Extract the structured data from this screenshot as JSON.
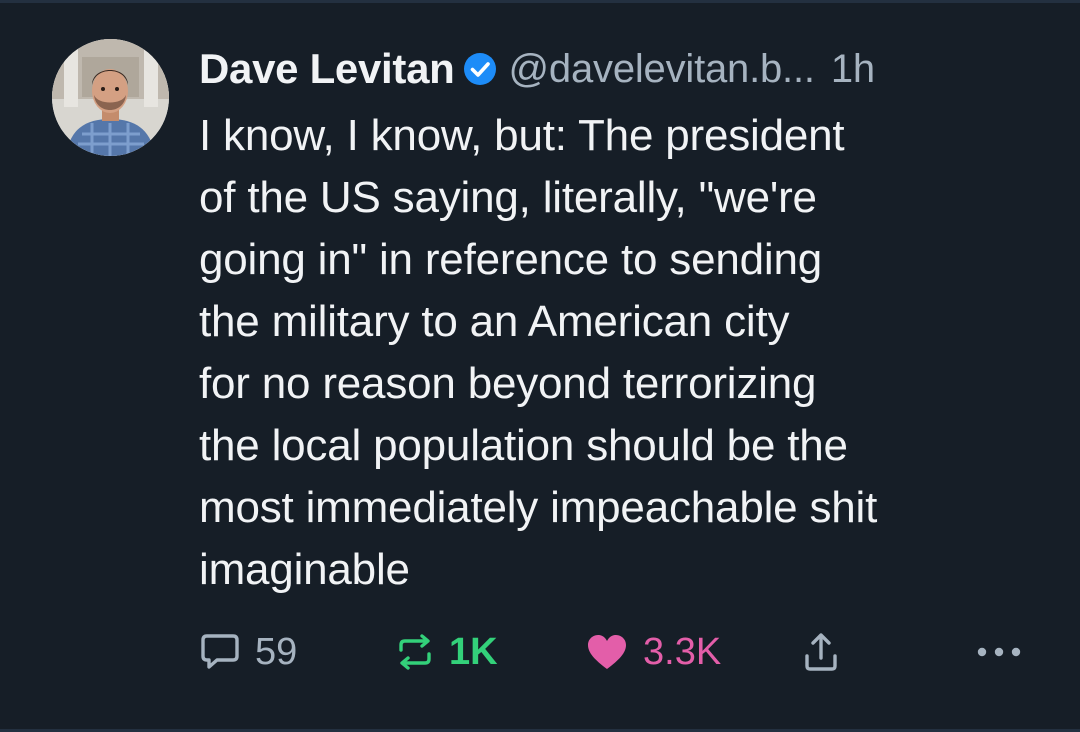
{
  "post": {
    "author": {
      "display_name": "Dave Levitan",
      "handle": "@davelevitan.b...",
      "verified": true
    },
    "timestamp": "1h",
    "text": "I know, I know, but: The president\nof the US saying, literally, \"we're\ngoing in\" in reference to sending\nthe military to an American city\nfor no reason beyond terrorizing\nthe local population should be the\nmost immediately impeachable shit\nimaginable",
    "actions": {
      "reply_count": "59",
      "repost_count": "1K",
      "like_count": "3.3K"
    }
  },
  "icons": {
    "avatar": "author-photo",
    "verified": "verified-check-icon",
    "reply": "speech-bubble-icon",
    "repost": "repost-arrows-icon",
    "like": "heart-icon",
    "share": "share-upload-icon",
    "more": "more-dots-icon"
  },
  "colors": {
    "background": "#161e27",
    "text": "#f1f3f5",
    "muted": "#a6b3c0",
    "verified": "#1d8cf8",
    "repost_active": "#33d17a",
    "like_active": "#e35ea9"
  }
}
